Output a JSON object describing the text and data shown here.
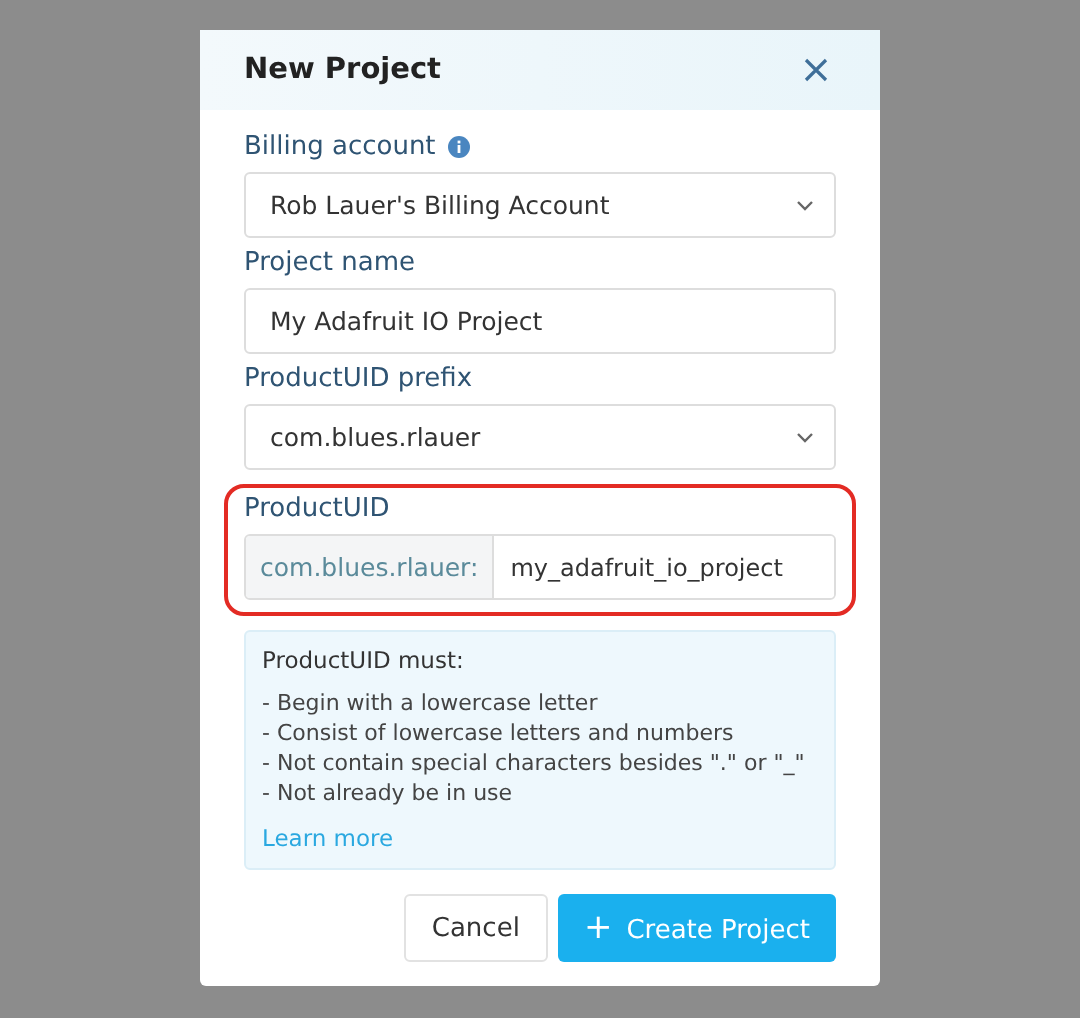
{
  "dialog": {
    "title": "New Project"
  },
  "fields": [
    {
      "kind": "select",
      "label": "Billing account",
      "info": true,
      "value": "Rob Lauer's Billing Account",
      "highlighted": false
    },
    {
      "kind": "text",
      "label": "Project name",
      "info": false,
      "value": "My Adafruit IO Project",
      "highlighted": false
    },
    {
      "kind": "select",
      "label": "ProductUID prefix",
      "info": false,
      "value": "com.blues.rlauer",
      "highlighted": false
    },
    {
      "kind": "prefixed",
      "label": "ProductUID",
      "info": false,
      "prefix": "com.blues.rlauer:",
      "value": "my_adafruit_io_project",
      "highlighted": true
    }
  ],
  "help": {
    "title": "ProductUID must:",
    "rules": [
      "- Begin with a lowercase letter",
      "- Consist of lowercase letters and numbers",
      "- Not contain special characters besides \".\" or \"_\"",
      "- Not already be in use"
    ],
    "link": "Learn more"
  },
  "buttons": [
    {
      "kind": "secondary",
      "label": "Cancel"
    },
    {
      "kind": "primary",
      "icon": "+",
      "label": "Create Project"
    }
  ]
}
